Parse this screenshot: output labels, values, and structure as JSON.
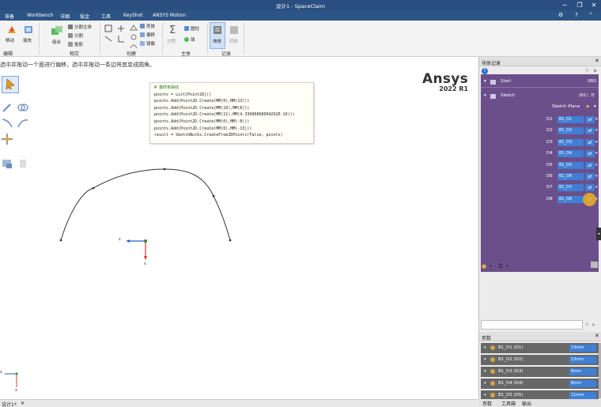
{
  "window": {
    "title": "设计1 - SpaceClaim",
    "help_icon": "help-icon",
    "minimize": "−",
    "restore": "❐",
    "close": "✕"
  },
  "menu": [
    "准备",
    "Workbench",
    "详细",
    "钣金",
    "工具",
    "KeyShot",
    "ANSYS Motion"
  ],
  "ribbon": {
    "buttons": {
      "move": "移动",
      "fill": "填充",
      "combine": "组合",
      "split_body": "分割主体",
      "split": "分割",
      "project": "投影",
      "shell": "壳体",
      "offset": "偏移",
      "mirror": "镜像",
      "measure": "方程",
      "cylinder": "圆柱",
      "sphere": "球",
      "block": "块体",
      "record": "回放"
    },
    "groups": {
      "edit": "编辑",
      "intersect": "相交",
      "create": "创建",
      "body": "主体",
      "record": "记录"
    }
  },
  "hint": "选中并拖动一个面进行偏移，选中并拖动一条边将其变成圆角。",
  "code": {
    "header": "# 猫样条曲线",
    "lines": [
      "points = List[Point2D]()",
      "points.Add(Point2D.Create(MM(0),MM(13)))",
      "points.Add(Point2D.Create(MM(10),MM(8)))",
      "points.Add(Point2D.Create(MM(11),MM(4.33680868994202E-16)))",
      "points.Add(Point2D.Create(MM(0),MM(-8)))",
      "points.Add(Point2D.Create(MM(0),MM(-13)))",
      "result = SketchNurbs.CreateFromZDPoints(False, points)"
    ]
  },
  "logo": {
    "brand": "Ansys",
    "version": "2022 R1"
  },
  "axis": {
    "z": "z",
    "x": "x"
  },
  "block_panel": {
    "title": "块体记录",
    "start": {
      "label": "Start",
      "tag": "(B0)"
    },
    "sketch": {
      "label": "Sketch",
      "tag": "(B1)"
    },
    "sketch_plane": "Sketch Plane",
    "rows": [
      {
        "id": "D1",
        "value": "B1_D1"
      },
      {
        "id": "D2",
        "value": "B1_D2"
      },
      {
        "id": "D3",
        "value": "B1_D3"
      },
      {
        "id": "D4",
        "value": "B1_D4"
      },
      {
        "id": "D5",
        "value": "B1_D5"
      },
      {
        "id": "D6",
        "value": "B1_D6"
      },
      {
        "id": "D7",
        "value": "B1_D7"
      },
      {
        "id": "D8",
        "value": "B1_D8"
      }
    ]
  },
  "params_panel": {
    "title": "参数",
    "rows": [
      {
        "name": "B1_D1 (D1)",
        "value": "13mm"
      },
      {
        "name": "B1_D2 (D2)",
        "value": "13mm"
      },
      {
        "name": "B1_D3 (D3)",
        "value": "8mm"
      },
      {
        "name": "B1_D4 (D4)",
        "value": "8mm"
      },
      {
        "name": "B1_D5 (D5)",
        "value": "11mm"
      }
    ]
  },
  "bottom_tabs": [
    "参数",
    "工具箱",
    "输出"
  ],
  "status": {
    "tab": "设计1*"
  }
}
